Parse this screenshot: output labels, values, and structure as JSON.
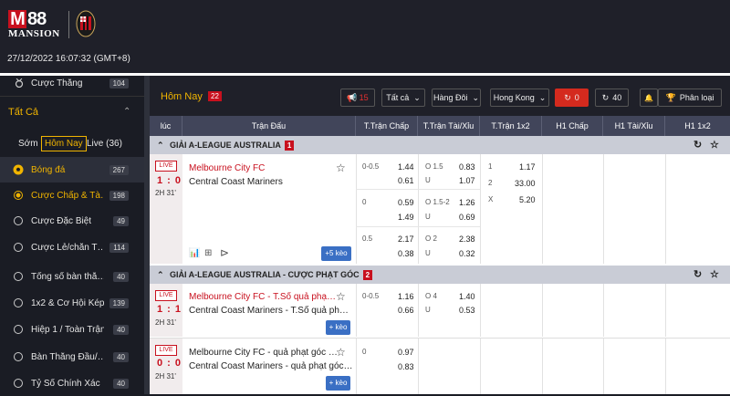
{
  "brand": {
    "logo_top": "88",
    "logo_bottom": "MANSION",
    "logo_m": "M"
  },
  "datetime": "27/12/2022 16:07:32 (GMT+8)",
  "sidebar": {
    "top_item": {
      "label": "Cược Thắng",
      "count": "104"
    },
    "section": "Tất Cả",
    "tabs": {
      "early": "Sớm",
      "today": "Hôm Nay",
      "live": "Live (36)"
    },
    "sport": {
      "label": "Bóng đá",
      "count": "267"
    },
    "items": [
      {
        "label": "Cược Chấp & Tà…",
        "count": "198"
      },
      {
        "label": "Cược Đặc Biệt",
        "count": "49"
      },
      {
        "label": "Cược Lẻ/chẵn T…",
        "count": "114"
      },
      {
        "label": "Tổng số bàn thắ…",
        "count": "40"
      },
      {
        "label": "1x2 & Cơ Hội Kép",
        "count": "139"
      },
      {
        "label": "Hiệp 1 / Toàn Trận",
        "count": "40"
      },
      {
        "label": "Bàn Thắng Đầu/…",
        "count": "40"
      },
      {
        "label": "Tỷ Số Chính Xác",
        "count": "40"
      }
    ]
  },
  "toolbar": {
    "title": "Hôm Nay",
    "title_count": "22",
    "flag_count": "15",
    "filter": "Tất cả",
    "sort": "Hàng Đôi",
    "odds": "Hong Kong",
    "refresh_count": "0",
    "reload_count": "40",
    "classify": "Phân loại"
  },
  "columns": [
    "lúc",
    "Trận Đấu",
    "T.Trận Chấp",
    "T.Trận Tài/Xỉu",
    "T.Trận 1x2",
    "H1 Chấp",
    "H1 Tài/Xỉu",
    "H1 1x2"
  ],
  "leagues": [
    {
      "name": "GIẢI A-LEAGUE AUSTRALIA",
      "count": "1"
    },
    {
      "name": "GIẢI A-LEAGUE AUSTRALIA - CƯỢC PHẠT GÓC",
      "count": "2"
    }
  ],
  "match1": {
    "live": "LIVE",
    "score": "1 : 0",
    "time": "2H 31'",
    "home": "Melbourne City FC",
    "away": "Central Coast Mariners",
    "more": "+5 kèo",
    "hdp": [
      {
        "line": "0-0.5",
        "h": "1.44",
        "a": "0.61"
      },
      {
        "line": "0",
        "h": "0.59",
        "a": "1.49"
      },
      {
        "line": "0.5",
        "h": "2.17",
        "a": "0.38"
      }
    ],
    "ou": [
      {
        "o": "O 1.5",
        "u": "U",
        "ov": "0.83",
        "uv": "1.07"
      },
      {
        "o": "O 1.5-2",
        "u": "U",
        "ov": "1.26",
        "uv": "0.69"
      },
      {
        "o": "O 2",
        "u": "U",
        "ov": "2.38",
        "uv": "0.32"
      }
    ],
    "x12": [
      {
        "k": "1",
        "v": "1.17"
      },
      {
        "k": "2",
        "v": "33.00"
      },
      {
        "k": "X",
        "v": "5.20"
      }
    ]
  },
  "match2": {
    "live": "LIVE",
    "score": "1 : 1",
    "time": "2H 31'",
    "home": "Melbourne City FC - T.Số quả phạ…",
    "away": "Central Coast Mariners - T.Số quả ph…",
    "more": "+ kèo",
    "hdp": {
      "line": "0-0.5",
      "h": "1.16",
      "a": "0.66"
    },
    "ou": {
      "o": "O 4",
      "u": "U",
      "ov": "1.40",
      "uv": "0.53"
    }
  },
  "match3": {
    "live": "LIVE",
    "score": "0 : 0",
    "time": "2H 31'",
    "home": "Melbourne City FC - quả phạt góc …",
    "away": "Central Coast Mariners - quả phạt góc…",
    "more": "+ kèo",
    "hdp": {
      "line": "0",
      "h": "0.97",
      "a": "0.83"
    }
  }
}
